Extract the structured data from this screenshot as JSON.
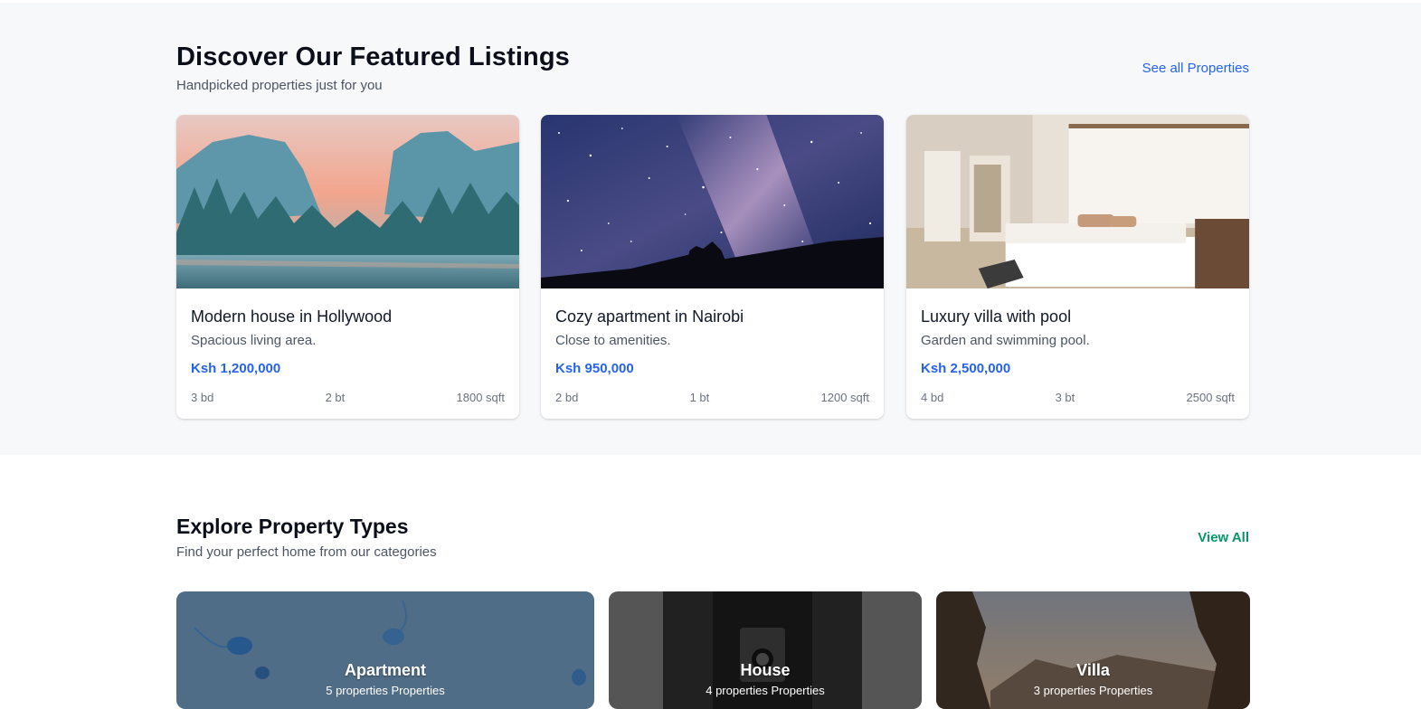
{
  "featured": {
    "title": "Discover Our Featured Listings",
    "subtitle": "Handpicked properties just for you",
    "see_all": "See all Properties",
    "listings": [
      {
        "title": "Modern house in Hollywood",
        "description": "Spacious living area.",
        "price": "Ksh 1,200,000",
        "beds": "3 bd",
        "baths": "2 bt",
        "area": "1800 sqft"
      },
      {
        "title": "Cozy apartment in Nairobi",
        "description": "Close to amenities.",
        "price": "Ksh 950,000",
        "beds": "2 bd",
        "baths": "1 bt",
        "area": "1200 sqft"
      },
      {
        "title": "Luxury villa with pool",
        "description": "Garden and swimming pool.",
        "price": "Ksh 2,500,000",
        "beds": "4 bd",
        "baths": "3 bt",
        "area": "2500 sqft"
      }
    ]
  },
  "types": {
    "title": "Explore Property Types",
    "subtitle": "Find your perfect home from our categories",
    "view_all": "View All",
    "categories": [
      {
        "label": "Apartment",
        "count": "5 properties Properties"
      },
      {
        "label": "House",
        "count": "4 properties Properties"
      },
      {
        "label": "Villa",
        "count": "3 properties Properties"
      }
    ]
  },
  "colors": {
    "accent_blue": "#2563eb",
    "accent_green": "#059669",
    "section_bg": "#f7f8fa"
  }
}
